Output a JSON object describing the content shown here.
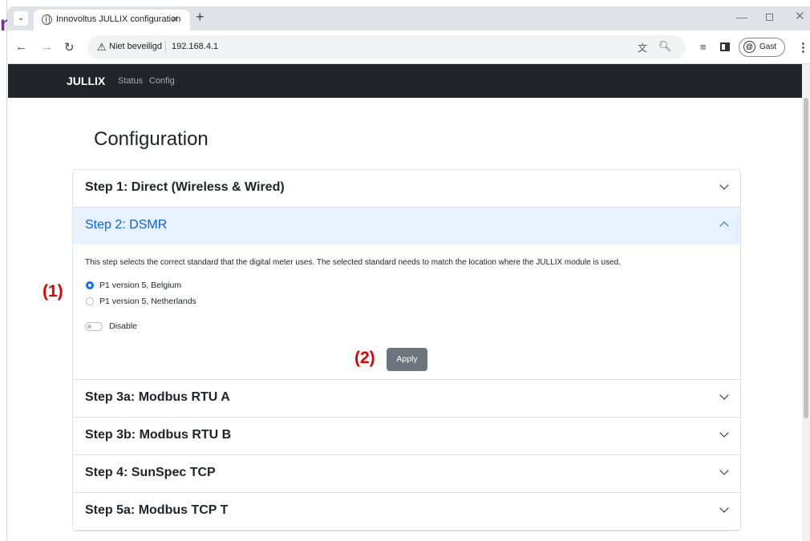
{
  "browser": {
    "tab_title": "Innovoltus JULLIX configuration",
    "not_secure_label": "Niet beveiligd",
    "url": "192.168.4.1",
    "profile_label": "Gast"
  },
  "left_artifact": {
    "char": "n"
  },
  "navbar": {
    "brand": "JULLIX",
    "links": [
      "Status",
      "Config"
    ]
  },
  "page": {
    "title": "Configuration"
  },
  "accordion": {
    "items": [
      {
        "title": "Step 1: Direct (Wireless & Wired)",
        "expanded": false
      },
      {
        "title": "Step 2: DSMR",
        "expanded": true
      },
      {
        "title": "Step 3a: Modbus RTU A",
        "expanded": false
      },
      {
        "title": "Step 3b: Modbus RTU B",
        "expanded": false
      },
      {
        "title": "Step 4: SunSpec TCP",
        "expanded": false
      },
      {
        "title": "Step 5a: Modbus TCP T",
        "expanded": false
      }
    ]
  },
  "dsmr": {
    "description": "This step selects the correct standard that the digital meter uses. The selected standard needs to match the location where the JULLIX module is used.",
    "options": [
      {
        "label": "P1 version 5, Belgium",
        "checked": true
      },
      {
        "label": "P1 version 5, Netherlands",
        "checked": false
      }
    ],
    "toggle_label": "Disable",
    "apply_label": "Apply"
  },
  "annotations": {
    "one": "(1)",
    "two": "(2)"
  },
  "colors": {
    "navbar_bg": "#212529",
    "accent": "#0d6efd",
    "active_header_bg": "#e7f1ff",
    "annotation": "#e00000"
  }
}
